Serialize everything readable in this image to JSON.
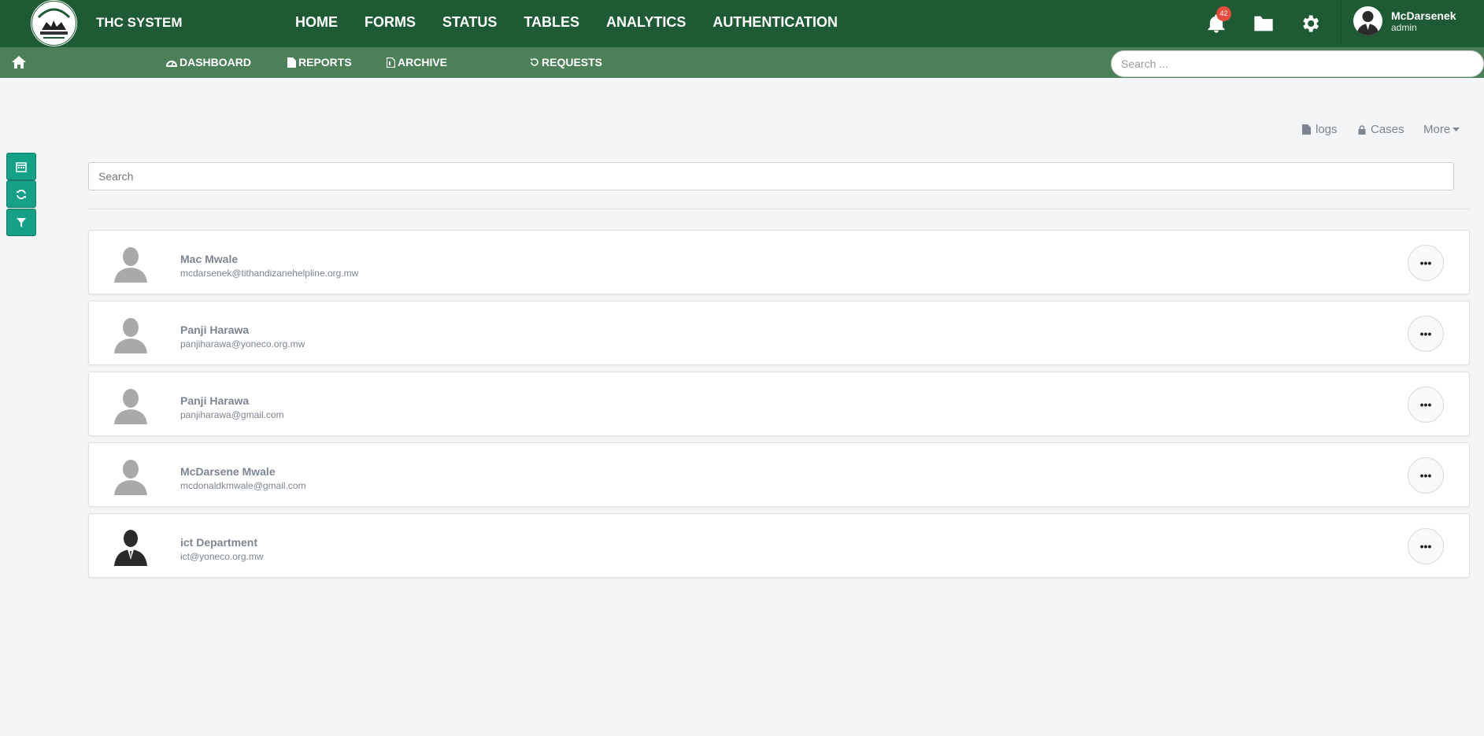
{
  "header": {
    "title": "THC SYSTEM",
    "nav": [
      "HOME",
      "FORMS",
      "STATUS",
      "TABLES",
      "ANALYTICS",
      "AUTHENTICATION"
    ],
    "notification_count": "42",
    "user": {
      "name": "McDarsenek",
      "role": "admin"
    }
  },
  "subnav": {
    "items": [
      "DASHBOARD",
      "REPORTS",
      "ARCHIVE",
      "REQUESTS"
    ],
    "search_placeholder": "Search ..."
  },
  "actions": {
    "logs": "logs",
    "cases": "Cases",
    "more": "More"
  },
  "search": {
    "placeholder": "Search"
  },
  "users": [
    {
      "name": "Mac Mwale",
      "email": "mcdarsenek@tithandizanehelpline.org.mw",
      "avatar": "placeholder"
    },
    {
      "name": "Panji Harawa",
      "email": "panjiharawa@yoneco.org.mw",
      "avatar": "placeholder"
    },
    {
      "name": "Panji Harawa",
      "email": "panjiharawa@gmail.com",
      "avatar": "placeholder"
    },
    {
      "name": "McDarsene Mwale",
      "email": "mcdonaldkmwale@gmail.com",
      "avatar": "placeholder"
    },
    {
      "name": "ict Department",
      "email": "ict@yoneco.org.mw",
      "avatar": "suit"
    }
  ],
  "more_label": "•••",
  "colors": {
    "header": "#1e5b34",
    "subnav": "#4c8059",
    "tool": "#16a085",
    "badge": "#e74c3c"
  }
}
